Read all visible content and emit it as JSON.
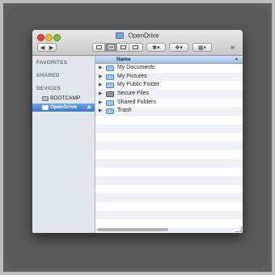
{
  "window": {
    "title": "OpenDrive"
  },
  "toolbar": {
    "back_glyph": "◀",
    "forward_glyph": "▶",
    "action_glyph": "✱▾",
    "dropbox_glyph": "❖▾",
    "arrange_glyph": "▦▾",
    "more_glyph": "»",
    "view_modes": [
      "icon-view",
      "list-view",
      "column-view",
      "cover-flow-view"
    ],
    "active_view": "list-view"
  },
  "sidebar": {
    "sections": [
      {
        "title": "FAVORITES"
      },
      {
        "title": "SHARED"
      },
      {
        "title": "DEVICES"
      }
    ],
    "devices": [
      {
        "label": "BOOTCAMP",
        "icon": "drive-icon",
        "selected": false
      },
      {
        "label": "OpenDrive",
        "icon": "drive-icon",
        "selected": true,
        "eject": "⏏"
      }
    ]
  },
  "list": {
    "column_header": "Name",
    "sort_glyph": "▲",
    "items": [
      {
        "label": "My Documents",
        "icon": "folder-icon"
      },
      {
        "label": "My Pictures",
        "icon": "folder-icon"
      },
      {
        "label": "My Public Folder",
        "icon": "folder-icon"
      },
      {
        "label": "Secure Files",
        "icon": "locked-folder-icon"
      },
      {
        "label": "Shared Folders",
        "icon": "folder-icon"
      },
      {
        "label": "Trash",
        "icon": "folder-icon"
      }
    ],
    "disclosure_glyph": "▶"
  },
  "colors": {
    "selection": "#3c79c9",
    "sidebar_bg": "#e1e6ec",
    "stripe": "#edf2f9"
  }
}
